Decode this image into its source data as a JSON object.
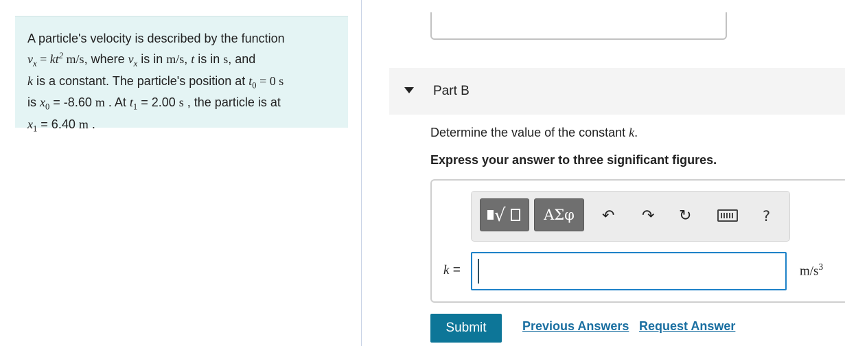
{
  "problem": {
    "line1": "A particle's velocity is described by the function",
    "eq_vx": "v",
    "eq_vx_sub": "x",
    "eq_equals": " = ",
    "eq_k": "kt",
    "eq_k_sup": "2",
    "eq_units": " m/s",
    "text_where": ", where ",
    "text_is_in": " is in ",
    "unit_ms": "m/s",
    "comma": ", ",
    "var_t": "t",
    "unit_s": "s",
    "text_and": ", and",
    "var_k": "k",
    "line3_text": " is a constant. The particle's position at ",
    "t0_var": "t",
    "t0_sub": "0",
    "t0_eq": " = 0 s",
    "line4_is": "is ",
    "x0_var": "x",
    "x0_sub": "0",
    "x0_value": " = -8.60 ",
    "unit_m": "m",
    "line4_at": " . At ",
    "t1_var": "t",
    "t1_sub": "1",
    "t1_value": " = 2.00 ",
    "line4_tail": " , the particle is at",
    "x1_var": "x",
    "x1_sub": "1",
    "x1_value": " = 6.40 ",
    "period": " ."
  },
  "part": {
    "title": "Part B"
  },
  "question": {
    "text": "Determine the value of the constant ",
    "var": "k",
    "end": "."
  },
  "instruction": "Express your answer to three significant figures.",
  "toolbar": {
    "greek_label": "ΑΣφ",
    "undo_glyph": "↶",
    "redo_glyph": "↷",
    "reset_glyph": "↻",
    "help_label": "?"
  },
  "answer": {
    "var_label": "k",
    "equals": " =",
    "value": "",
    "unit_base": "m/s",
    "unit_sup": "3"
  },
  "actions": {
    "submit_label": "Submit",
    "previous_answers_label": "Previous Answers",
    "request_answer_label": "Request Answer"
  },
  "colors": {
    "problem_bg": "#e4f4f4",
    "submit_bg": "#0d7698",
    "link": "#1a6fa1",
    "input_border": "#1e82c8"
  }
}
